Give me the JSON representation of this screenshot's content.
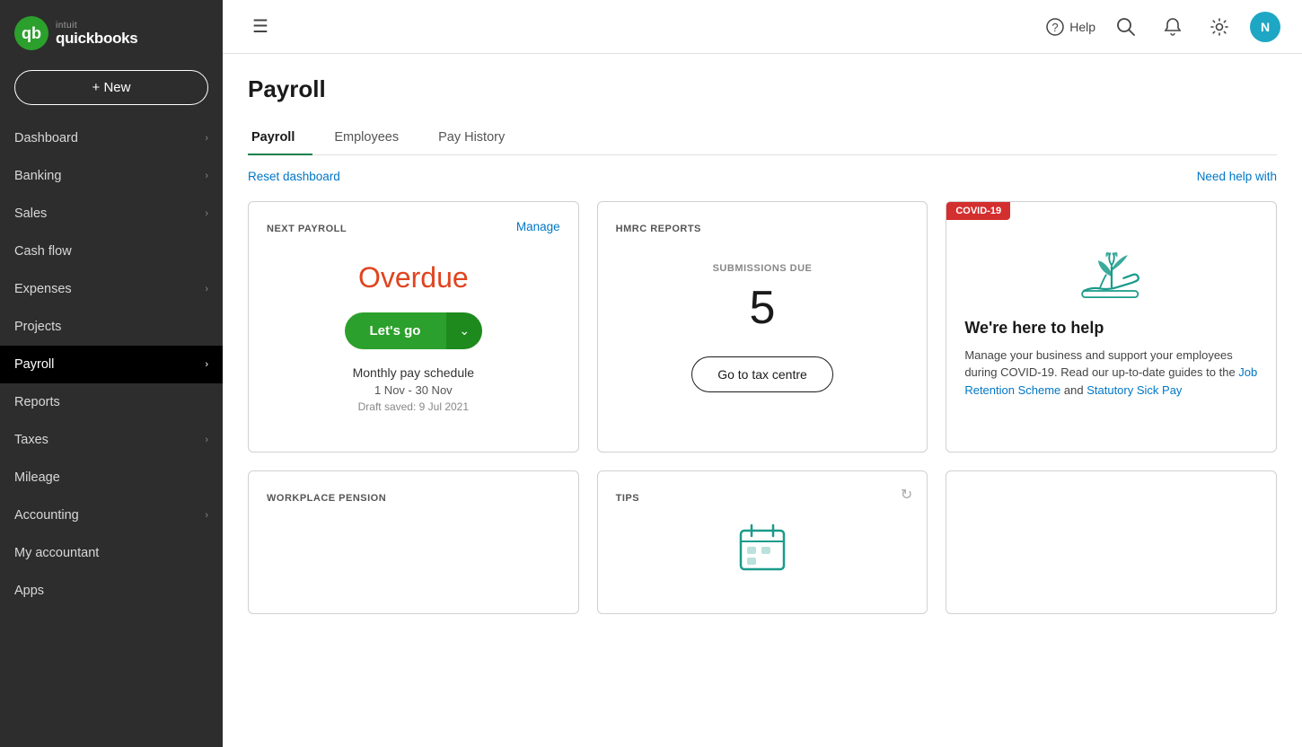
{
  "sidebar": {
    "logo": {
      "intuit": "intuit",
      "quickbooks": "quickbooks"
    },
    "new_button": "+ New",
    "items": [
      {
        "label": "Dashboard",
        "hasChevron": true,
        "active": false
      },
      {
        "label": "Banking",
        "hasChevron": true,
        "active": false
      },
      {
        "label": "Sales",
        "hasChevron": true,
        "active": false
      },
      {
        "label": "Cash flow",
        "hasChevron": false,
        "active": false
      },
      {
        "label": "Expenses",
        "hasChevron": true,
        "active": false
      },
      {
        "label": "Projects",
        "hasChevron": false,
        "active": false
      },
      {
        "label": "Payroll",
        "hasChevron": true,
        "active": true
      },
      {
        "label": "Reports",
        "hasChevron": false,
        "active": false
      },
      {
        "label": "Taxes",
        "hasChevron": true,
        "active": false
      },
      {
        "label": "Mileage",
        "hasChevron": false,
        "active": false
      },
      {
        "label": "Accounting",
        "hasChevron": true,
        "active": false
      },
      {
        "label": "My accountant",
        "hasChevron": false,
        "active": false
      },
      {
        "label": "Apps",
        "hasChevron": false,
        "active": false
      }
    ]
  },
  "topbar": {
    "help": "Help",
    "avatar": "N"
  },
  "page": {
    "title": "Payroll",
    "tabs": [
      {
        "label": "Payroll",
        "active": true
      },
      {
        "label": "Employees",
        "active": false
      },
      {
        "label": "Pay History",
        "active": false
      }
    ],
    "reset_link": "Reset dashboard",
    "need_help": "Need help with"
  },
  "cards": {
    "next_payroll": {
      "label": "NEXT PAYROLL",
      "manage_link": "Manage",
      "status": "Overdue",
      "lets_go": "Let's go",
      "schedule": "Monthly pay schedule",
      "dates": "1 Nov - 30 Nov",
      "draft": "Draft saved: 9 Jul 2021"
    },
    "hmrc": {
      "label": "HMRC REPORTS",
      "submissions_label": "SUBMISSIONS DUE",
      "count": "5",
      "button": "Go to tax centre"
    },
    "covid": {
      "badge": "COVID-19",
      "title": "We're here to help",
      "desc": "Manage your business and support your employees during COVID-19. Read our up-to-date guides to the",
      "link1": "Job Retention Scheme",
      "and": " and ",
      "link2": "Statutory Sick Pay"
    },
    "pension": {
      "label": "WORKPLACE PENSION"
    },
    "tips": {
      "label": "TIPS"
    }
  }
}
